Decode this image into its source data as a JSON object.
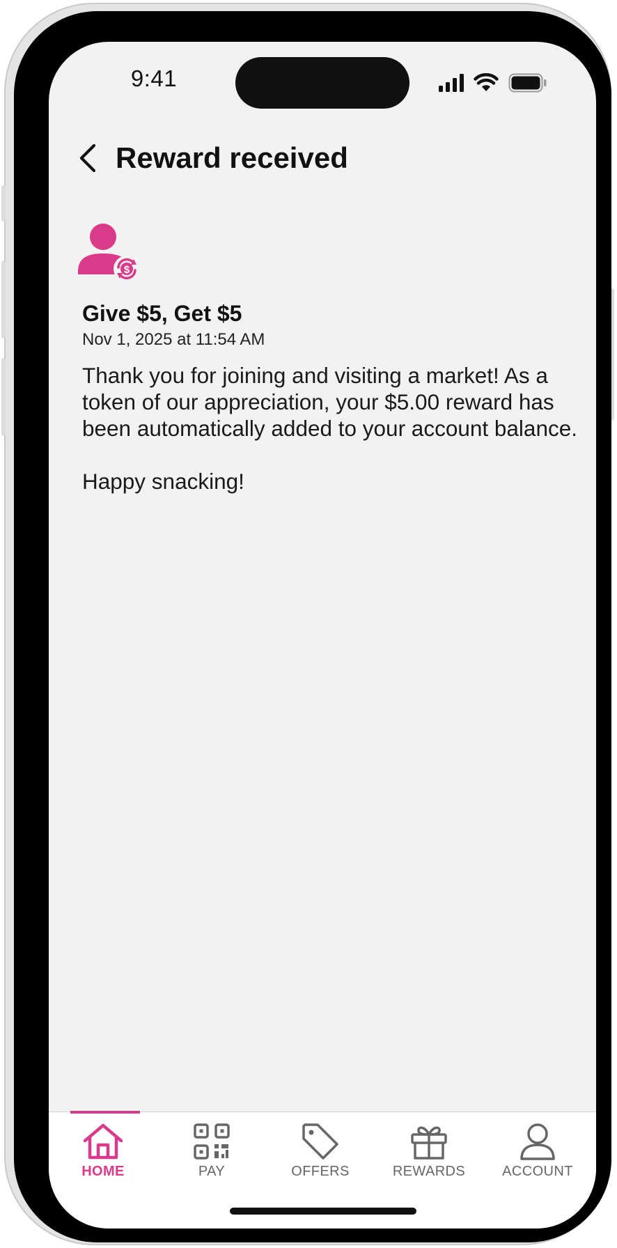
{
  "status_bar": {
    "time": "9:41",
    "icons": [
      "cellular-signal-icon",
      "wifi-icon",
      "battery-icon"
    ]
  },
  "header": {
    "back_icon": "chevron-left-icon",
    "title": "Reward received"
  },
  "reward": {
    "icon": "user-dollar-icon",
    "title": "Give $5, Get $5",
    "date": "Nov 1, 2025 at 11:54 AM",
    "message": [
      "Thank you for joining and visiting a market! As a token of our appreciation, your $5.00 reward has been automatically added to your account balance.",
      "Happy snacking!"
    ]
  },
  "tab_bar": {
    "tabs": [
      {
        "label": "HOME",
        "icon": "home-icon",
        "active": true
      },
      {
        "label": "PAY",
        "icon": "qr-code-icon",
        "active": false
      },
      {
        "label": "OFFERS",
        "icon": "tag-icon",
        "active": false
      },
      {
        "label": "REWARDS",
        "icon": "gift-icon",
        "active": false
      },
      {
        "label": "ACCOUNT",
        "icon": "user-icon",
        "active": false
      }
    ]
  },
  "colors": {
    "accent": "#d93a8a",
    "text": "#111111",
    "background": "#f2f2f2",
    "inactive_tab": "#666666"
  }
}
